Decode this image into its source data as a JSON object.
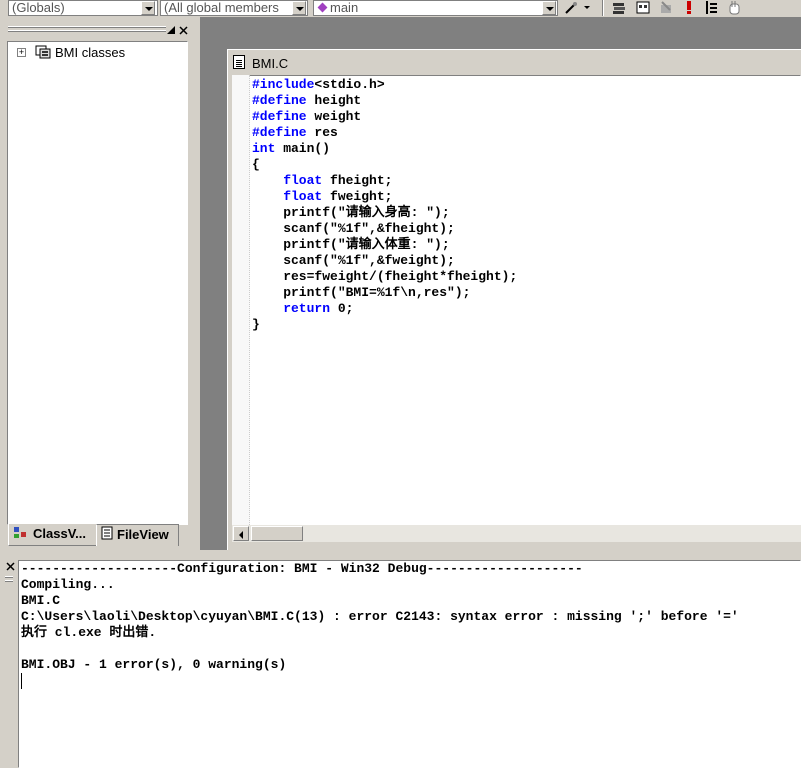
{
  "toolbar": {
    "scope_combo": "(Globals)",
    "members_combo": "(All global members",
    "function_combo": "main"
  },
  "workspace": {
    "tree_root_label": "BMI classes",
    "tabs": [
      {
        "label": "ClassV..."
      },
      {
        "label": "FileView"
      }
    ]
  },
  "editor": {
    "title": "BMI.C",
    "lines": [
      {
        "kw": "#include",
        "rest": "<stdio.h>"
      },
      {
        "kw": "#define",
        "rest": " height"
      },
      {
        "kw": "#define",
        "rest": " weight"
      },
      {
        "kw": "#define",
        "rest": " res"
      },
      {
        "kw": "int",
        "rest": " main()"
      },
      {
        "kw": "",
        "rest": "{"
      },
      {
        "kw": "    float",
        "rest": " fheight;"
      },
      {
        "kw": "    float",
        "rest": " fweight;"
      },
      {
        "kw": "",
        "rest": "    printf(\"请输入身高: \");"
      },
      {
        "kw": "",
        "rest": "    scanf(\"%1f\",&fheight);"
      },
      {
        "kw": "",
        "rest": "    printf(\"请输入体重: \");"
      },
      {
        "kw": "",
        "rest": "    scanf(\"%1f\",&fweight);"
      },
      {
        "kw": "",
        "rest": "    res=fweight/(fheight*fheight);"
      },
      {
        "kw": "",
        "rest": "    printf(\"BMI=%1f\\n,res\");"
      },
      {
        "kw": "    return",
        "rest": " 0;"
      },
      {
        "kw": "",
        "rest": "}"
      }
    ]
  },
  "output": {
    "lines": [
      "--------------------Configuration: BMI - Win32 Debug--------------------",
      "Compiling...",
      "BMI.C",
      "C:\\Users\\laoli\\Desktop\\cyuyan\\BMI.C(13) : error C2143: syntax error : missing ';' before '='",
      "执行 cl.exe 时出错.",
      "",
      "BMI.OBJ - 1 error(s), 0 warning(s)"
    ]
  },
  "colors": {
    "keyword": "#0000ff",
    "chrome": "#d4d0c8",
    "mdi_background": "#808080"
  }
}
